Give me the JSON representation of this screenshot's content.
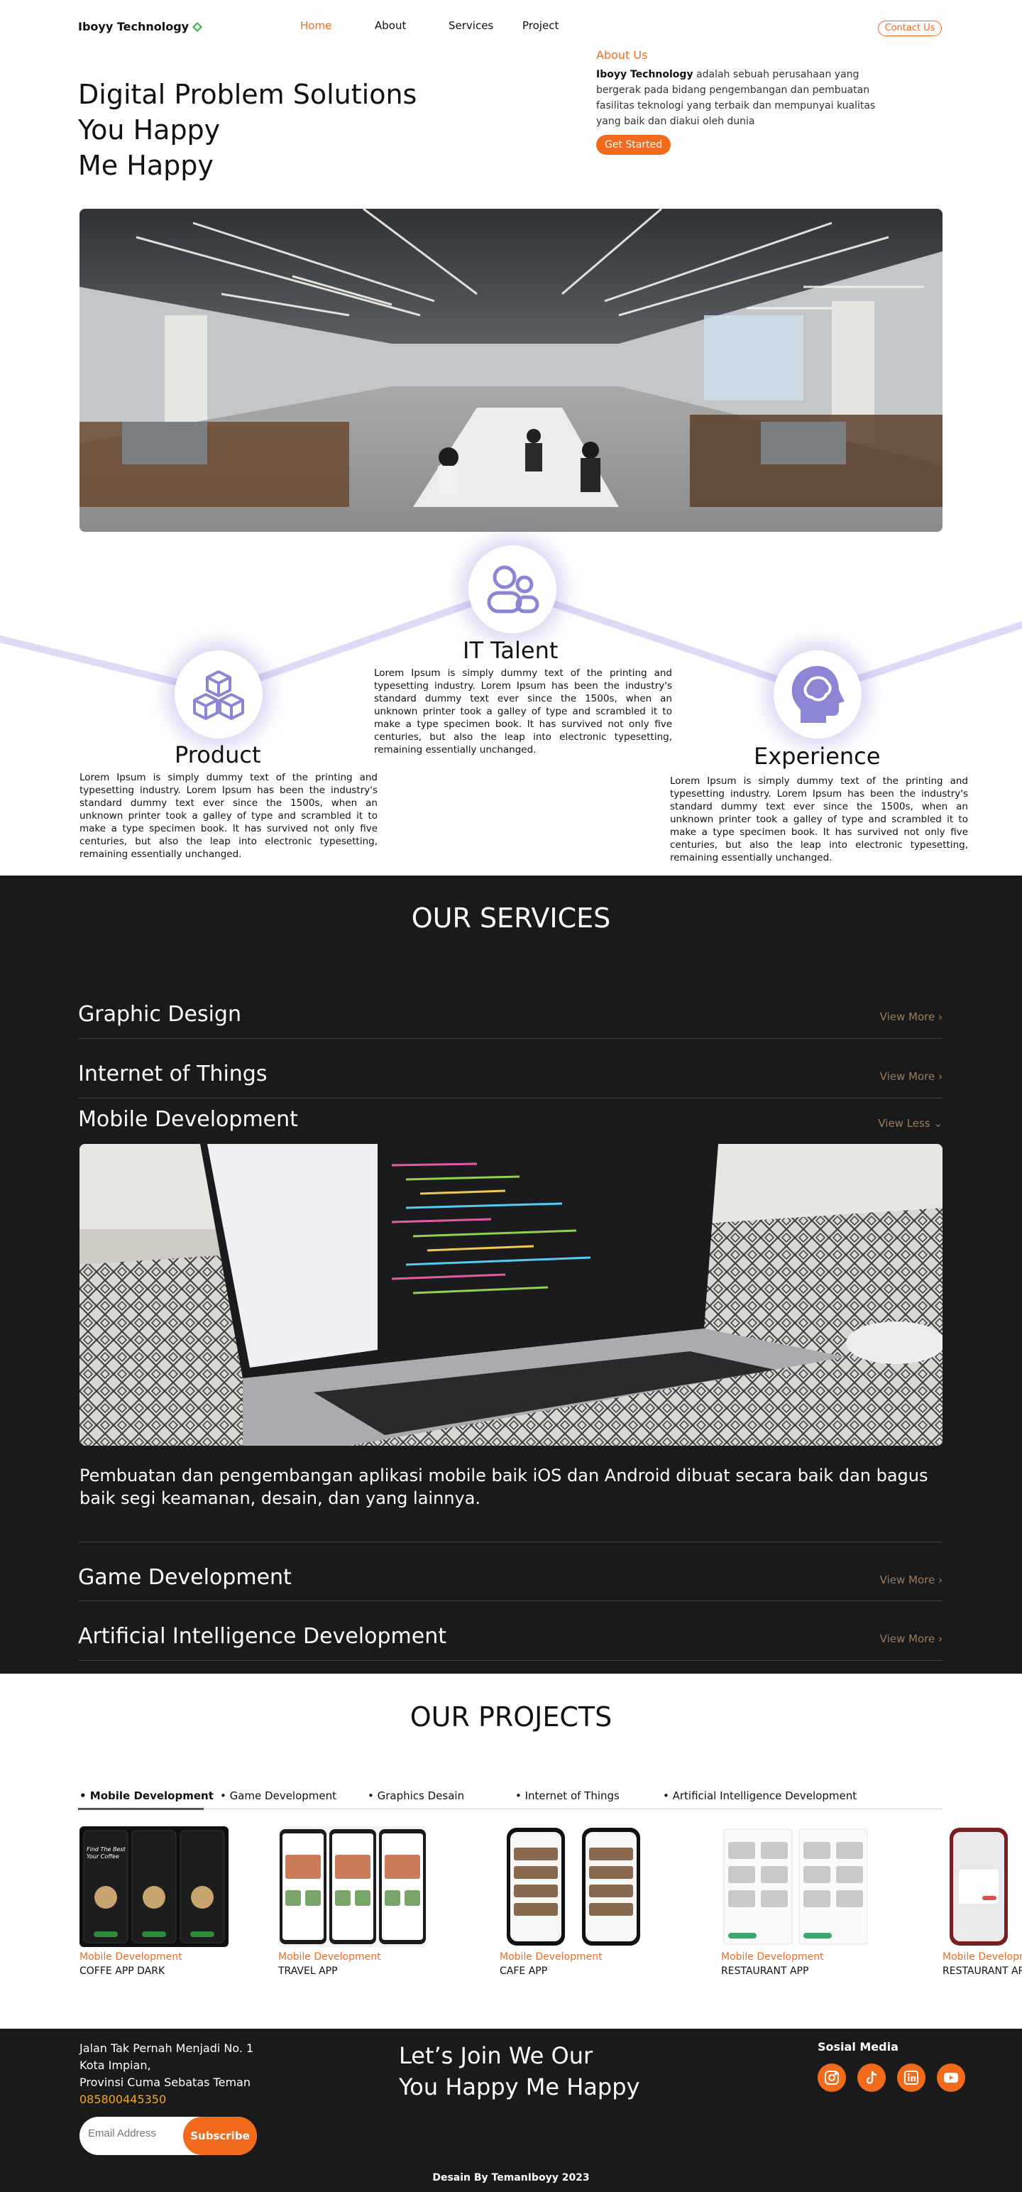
{
  "nav": {
    "logo": "Iboyy Technology",
    "links": [
      {
        "label": "Home",
        "active": true
      },
      {
        "label": "About",
        "active": false
      },
      {
        "label": "Services",
        "active": false
      },
      {
        "label": "Project",
        "active": false
      }
    ],
    "contact_label": "Contact Us",
    "accent_color": "#f26b1d"
  },
  "hero": {
    "title_lines": [
      "Digital Problem Solutions",
      "You Happy",
      "Me Happy"
    ],
    "about_label": "About Us",
    "about_brand": "Iboyy Technology",
    "about_text": " adalah sebuah perusahaan yang bergerak pada bidang pengembangan dan pembuatan fasilitas teknologi yang terbaik dan mempunyai kualitas yang baik dan diakui oleh dunia",
    "cta_label": "Get Started"
  },
  "features": [
    {
      "title": "Product",
      "icon": "cubes-icon",
      "text": "Lorem Ipsum is simply dummy text of the printing and typesetting industry. Lorem Ipsum has been the industry's standard dummy text ever since the 1500s, when an unknown printer took a galley of type and scrambled it to make a type specimen book. It has survived not only five centuries, but also the leap into electronic typesetting, remaining essentially unchanged."
    },
    {
      "title": "IT Talent",
      "icon": "people-icon",
      "text": "Lorem Ipsum is simply dummy text of the printing and typesetting industry. Lorem Ipsum has been the industry's standard dummy text ever since the 1500s, when an unknown printer took a galley of type and scrambled it to make a type specimen book. It has survived not only five centuries, but also the leap into electronic typesetting, remaining essentially unchanged."
    },
    {
      "title": "Experience",
      "icon": "brain-head-icon",
      "text": "Lorem Ipsum is simply dummy text of the printing and typesetting industry. Lorem Ipsum has been the industry's standard dummy text ever since the 1500s, when an unknown printer took a galley of type and scrambled it to make a type specimen book. It has survived not only five centuries, but also the leap into electronic typesetting, remaining essentially unchanged."
    }
  ],
  "services": {
    "title": "OUR SERVICES",
    "items": [
      {
        "name": "Graphic Design",
        "link": "View More ›"
      },
      {
        "name": "Internet of Things",
        "link": "View More ›"
      },
      {
        "name": "Mobile Development",
        "link": "View Less ⌄"
      },
      {
        "name": "Game Development",
        "link": "View More ›"
      },
      {
        "name": "Artificial Intelligence Development",
        "link": "View More ›"
      }
    ],
    "expanded_description": "Pembuatan dan pengembangan aplikasi mobile baik iOS dan Android dibuat secara baik dan bagus baik segi keamanan, desain, dan yang lainnya."
  },
  "projects": {
    "title": "OUR PROJECTS",
    "tabs": [
      "• Mobile Development",
      "• Game Development",
      "• Graphics Desain",
      "• Internet of Things",
      "• Artificial Intelligence Development"
    ],
    "items": [
      {
        "category": "Mobile Development",
        "name": "COFFE APP DARK",
        "thumb_title": "Find The Best Your Coffee"
      },
      {
        "category": "Mobile Development",
        "name": "TRAVEL APP",
        "thumb_title": ""
      },
      {
        "category": "Mobile Development",
        "name": "CAFE APP",
        "thumb_title": ""
      },
      {
        "category": "Mobile Development",
        "name": "RESTAURANT APP",
        "thumb_title": ""
      },
      {
        "category": "Mobile Development",
        "name": "RESTAURANT APP",
        "thumb_title": ""
      }
    ]
  },
  "footer": {
    "address_lines": [
      "Jalan Tak Pernah Menjadi No. 1",
      "Kota Impian,",
      "Provinsi Cuma Sebatas Teman"
    ],
    "phone": "085800445350",
    "email_placeholder": "Email Address",
    "subscribe_label": "Subscribe",
    "join_lines": [
      "Let’s Join We Our",
      "You Happy Me Happy"
    ],
    "social_title": "Sosial Media",
    "social_icons": [
      "instagram-icon",
      "tiktok-icon",
      "linkedin-icon",
      "youtube-icon"
    ],
    "credit": "Desain By TemanIboyy 2023"
  }
}
